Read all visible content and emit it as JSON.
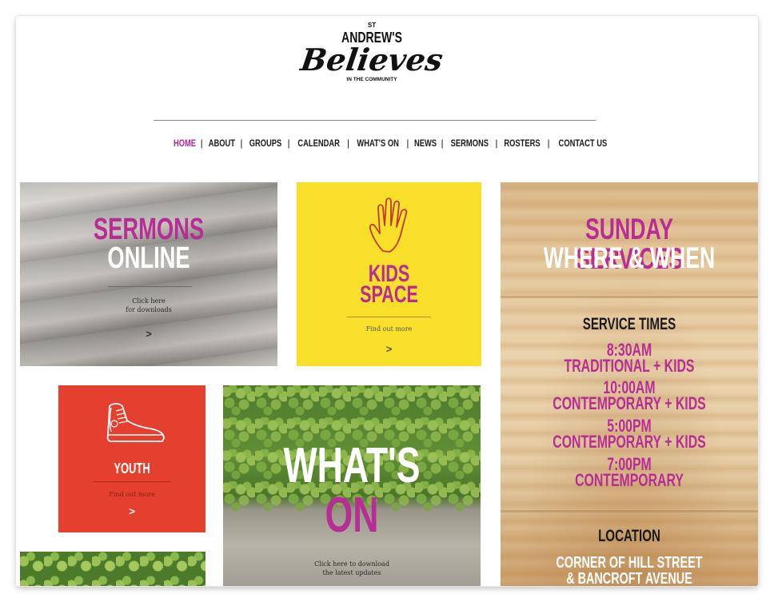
{
  "logo": {
    "st": "ST",
    "andrews": "ANDREW'S",
    "believes": "Believes",
    "community": "IN THE COMMUNITY"
  },
  "nav": {
    "items": [
      {
        "label": "HOME",
        "active": true
      },
      {
        "label": "ABOUT"
      },
      {
        "label": "GROUPS"
      },
      {
        "label": "CALENDAR"
      },
      {
        "label": "WHAT'S ON"
      },
      {
        "label": "NEWS"
      },
      {
        "label": "SERMONS"
      },
      {
        "label": "ROSTERS"
      },
      {
        "label": "CONTACT US"
      }
    ],
    "separator": "|"
  },
  "tiles": {
    "sermons": {
      "line1": "SERMONS",
      "line2": "ONLINE",
      "sub1": "Click here",
      "sub2": "for downloads",
      "arrow": ">"
    },
    "kids": {
      "line1": "KIDS",
      "line2": "SPACE",
      "sub": "Find out more",
      "arrow": ">",
      "icon": "hand-icon"
    },
    "youth": {
      "title": "YOUTH",
      "sub": "Find out more",
      "arrow": ">",
      "icon": "sneaker-icon"
    },
    "whatson": {
      "line1": "WHAT'S",
      "line2": "ON",
      "sub1": "Click here to download",
      "sub2": "the latest updates"
    },
    "sunday": {
      "title1": "SUNDAY SERVICES",
      "title2": "WHERE & WHEN",
      "service_times_title": "SERVICE TIMES",
      "services": [
        {
          "time": "8:30AM",
          "desc": "TRADITIONAL + KIDS"
        },
        {
          "time": "10:00AM",
          "desc": "CONTEMPORARY + KIDS"
        },
        {
          "time": "5:00PM",
          "desc": "CONTEMPORARY + KIDS"
        },
        {
          "time": "7:00PM",
          "desc": "CONTEMPORARY"
        }
      ],
      "location_title": "LOCATION",
      "address1": "CORNER OF HILL STREET",
      "address2": "& BANCROFT AVENUE"
    }
  },
  "colors": {
    "magenta": "#b82d95",
    "yellow": "#f7df2a",
    "red": "#e5402f"
  }
}
